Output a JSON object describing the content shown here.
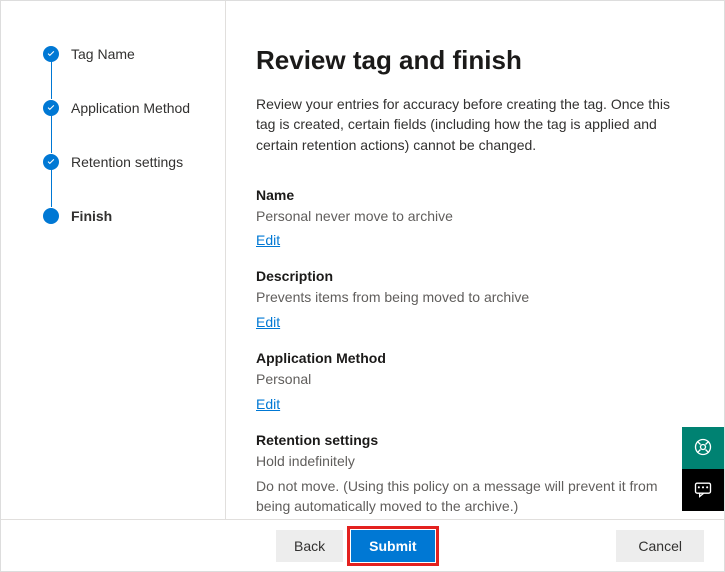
{
  "sidebar": {
    "steps": [
      {
        "label": "Tag Name",
        "done": true
      },
      {
        "label": "Application Method",
        "done": true
      },
      {
        "label": "Retention settings",
        "done": true
      },
      {
        "label": "Finish",
        "current": true
      }
    ]
  },
  "main": {
    "title": "Review tag and finish",
    "intro": "Review your entries for accuracy before creating the tag. Once this tag is created, certain fields (including how the tag is applied and certain retention actions) cannot be changed.",
    "edit_label": "Edit",
    "sections": {
      "name": {
        "label": "Name",
        "value": "Personal never move to archive"
      },
      "description": {
        "label": "Description",
        "value": "Prevents items from being moved to archive"
      },
      "application_method": {
        "label": "Application Method",
        "value": "Personal"
      },
      "retention": {
        "label": "Retention settings",
        "value1": "Hold indefinitely",
        "value2": "Do not move. (Using this policy on a message will prevent it from being automatically moved to the archive.)"
      }
    }
  },
  "footer": {
    "back": "Back",
    "submit": "Submit",
    "cancel": "Cancel"
  }
}
